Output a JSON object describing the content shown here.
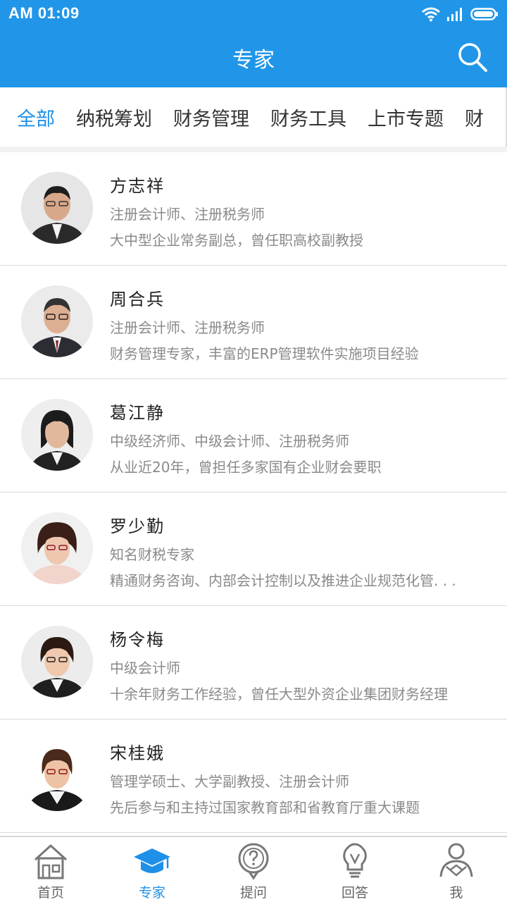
{
  "status_bar": {
    "time": "AM 01:09"
  },
  "header": {
    "title": "专家"
  },
  "tabs": [
    "全部",
    "纳税筹划",
    "财务管理",
    "财务工具",
    "上市专题",
    "财"
  ],
  "active_tab": 0,
  "experts": [
    {
      "name": "方志祥",
      "title": "注册会计师、注册税务师",
      "desc": "大中型企业常务副总，曾任职高校副教授"
    },
    {
      "name": "周合兵",
      "title": "注册会计师、注册税务师",
      "desc": "财务管理专家，丰富的ERP管理软件实施项目经验"
    },
    {
      "name": "葛江静",
      "title": "中级经济师、中级会计师、注册税务师",
      "desc": "从业近20年，曾担任多家国有企业财会要职"
    },
    {
      "name": "罗少勤",
      "title": "知名财税专家",
      "desc": "精通财务咨询、内部会计控制以及推进企业规范化管. . ."
    },
    {
      "name": "杨令梅",
      "title": "中级会计师",
      "desc": "十余年财务工作经验，曾任大型外资企业集团财务经理"
    },
    {
      "name": "宋桂娥",
      "title": "管理学硕士、大学副教授、注册会计师",
      "desc": "先后参与和主持过国家教育部和省教育厅重大课题"
    }
  ],
  "bottom_nav": [
    {
      "label": "首页",
      "icon": "home-icon"
    },
    {
      "label": "专家",
      "icon": "graduation-cap-icon"
    },
    {
      "label": "提问",
      "icon": "question-bubble-icon"
    },
    {
      "label": "回答",
      "icon": "lightbulb-icon"
    },
    {
      "label": "我",
      "icon": "person-icon"
    }
  ],
  "colors": {
    "primary": "#2196e8",
    "active_text": "#1e90e8",
    "secondary_text": "#8a8a8a"
  }
}
